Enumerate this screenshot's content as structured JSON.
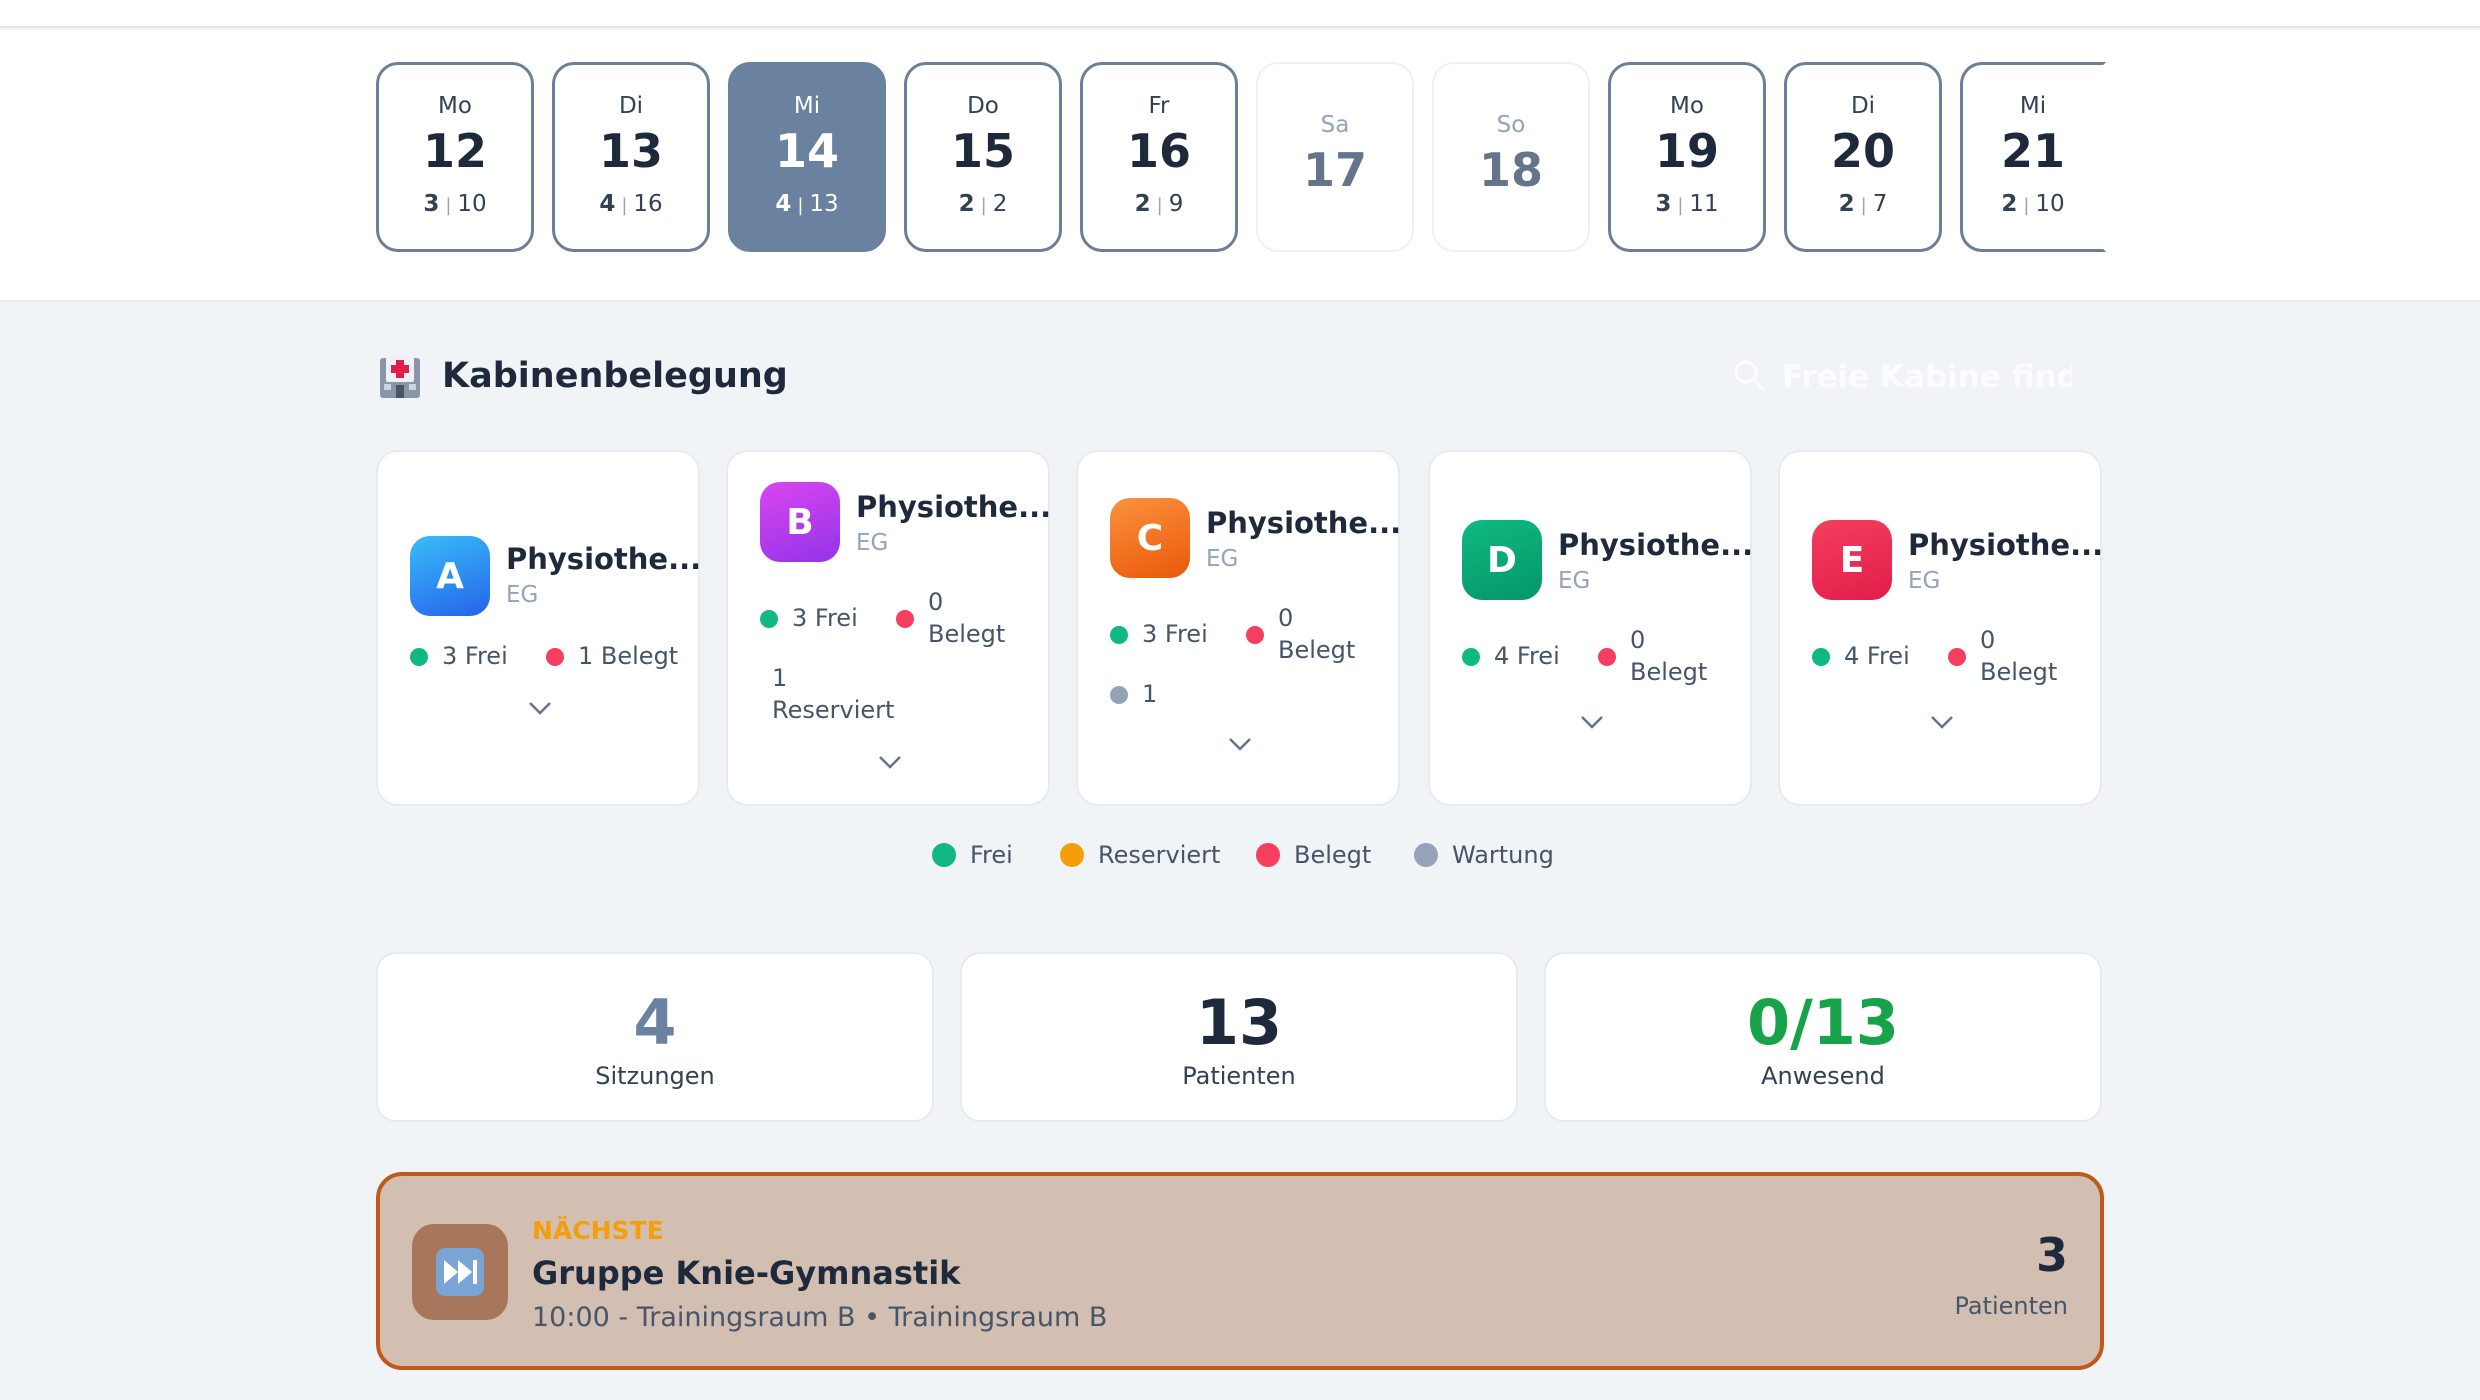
{
  "days": [
    {
      "weekday": "Mo",
      "date": "12",
      "sessions": "3",
      "patients": "10",
      "state": "normal"
    },
    {
      "weekday": "Di",
      "date": "13",
      "sessions": "4",
      "patients": "16",
      "state": "normal"
    },
    {
      "weekday": "Mi",
      "date": "14",
      "sessions": "4",
      "patients": "13",
      "state": "active"
    },
    {
      "weekday": "Do",
      "date": "15",
      "sessions": "2",
      "patients": "2",
      "state": "normal"
    },
    {
      "weekday": "Fr",
      "date": "16",
      "sessions": "2",
      "patients": "9",
      "state": "normal"
    },
    {
      "weekday": "Sa",
      "date": "17",
      "state": "weekend"
    },
    {
      "weekday": "So",
      "date": "18",
      "state": "weekend"
    },
    {
      "weekday": "Mo",
      "date": "19",
      "sessions": "3",
      "patients": "11",
      "state": "normal"
    },
    {
      "weekday": "Di",
      "date": "20",
      "sessions": "2",
      "patients": "7",
      "state": "normal"
    },
    {
      "weekday": "Mi",
      "date": "21",
      "sessions": "2",
      "patients": "10",
      "state": "normal"
    }
  ],
  "section": {
    "icon": "hospital-icon",
    "title": "Kabinenbelegung",
    "search_placeholder": "Freie Kabine finden"
  },
  "cabins": [
    {
      "letter": "A",
      "name": "Physiothe...",
      "floor": "EG",
      "free": "3 Frei",
      "occupied": "1 Belegt",
      "color_top": "#38bdf8",
      "color_bottom": "#2563eb"
    },
    {
      "letter": "B",
      "name": "Physiothe...",
      "floor": "EG",
      "free": "3 Frei",
      "occupied_num": "0",
      "occupied_label": "Belegt",
      "reserved_num": "1",
      "reserved_label": "Reserviert",
      "color_top": "#d946ef",
      "color_bottom": "#9333ea"
    },
    {
      "letter": "C",
      "name": "Physiothe...",
      "floor": "EG",
      "free": "3 Frei",
      "occupied_num": "0",
      "occupied_label": "Belegt",
      "maintenance": "1",
      "color_top": "#fb923c",
      "color_bottom": "#ea580c"
    },
    {
      "letter": "D",
      "name": "Physiothe...",
      "floor": "EG",
      "free": "4 Frei",
      "occupied_num": "0",
      "occupied_label": "Belegt",
      "color_top": "#10b981",
      "color_bottom": "#059669"
    },
    {
      "letter": "E",
      "name": "Physiothe...",
      "floor": "EG",
      "free": "4 Frei",
      "occupied_num": "0",
      "occupied_label": "Belegt",
      "color_top": "#f43f5e",
      "color_bottom": "#e11d48"
    }
  ],
  "legend": [
    {
      "label": "Frei",
      "color": "#10b981"
    },
    {
      "label": "Reserviert",
      "color": "#f59e0b"
    },
    {
      "label": "Belegt",
      "color": "#f43f5e"
    },
    {
      "label": "Wartung",
      "color": "#94a3b8"
    }
  ],
  "status_colors": {
    "free": "#10b981",
    "reserved": "#f59e0b",
    "occupied": "#f43f5e",
    "maintenance": "#94a3b8"
  },
  "kpis": [
    {
      "value": "4",
      "label": "Sitzungen",
      "color": "#6a829f"
    },
    {
      "value": "13",
      "label": "Patienten",
      "color": "#1e293b"
    },
    {
      "value": "0/13",
      "label": "Anwesend",
      "color": "#16a34a"
    }
  ],
  "next": {
    "icon": "fast-forward-icon",
    "tag": "NÄCHSTE",
    "title": "Gruppe Knie-Gymnastik",
    "subtitle": "10:00 - Trainingsraum B • Trainingsraum B",
    "count": "3",
    "count_label": "Patienten"
  }
}
